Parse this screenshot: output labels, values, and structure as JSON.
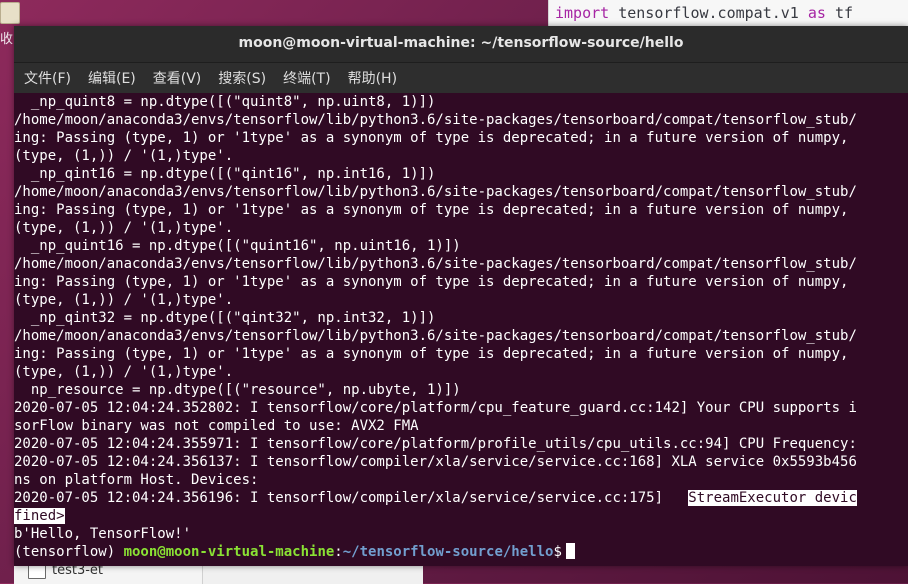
{
  "desktop": {
    "left_fragment": "收",
    "editor_line": {
      "keyword1": "import",
      "module": " tensorflow.compat.v1 ",
      "keyword2": "as",
      "alias": " tf"
    },
    "file_item": "test3-et"
  },
  "terminal": {
    "title": "moon@moon-virtual-machine: ~/tensorflow-source/hello",
    "menu": [
      "文件(F)",
      "编辑(E)",
      "查看(V)",
      "搜索(S)",
      "终端(T)",
      "帮助(H)"
    ],
    "lines": [
      "  _np_quint8 = np.dtype([(\"quint8\", np.uint8, 1)])",
      "/home/moon/anaconda3/envs/tensorflow/lib/python3.6/site-packages/tensorboard/compat/tensorflow_stub/",
      "ing: Passing (type, 1) or '1type' as a synonym of type is deprecated; in a future version of numpy, ",
      "(type, (1,)) / '(1,)type'.",
      "  _np_qint16 = np.dtype([(\"qint16\", np.int16, 1)])",
      "/home/moon/anaconda3/envs/tensorflow/lib/python3.6/site-packages/tensorboard/compat/tensorflow_stub/",
      "ing: Passing (type, 1) or '1type' as a synonym of type is deprecated; in a future version of numpy, ",
      "(type, (1,)) / '(1,)type'.",
      "  _np_quint16 = np.dtype([(\"quint16\", np.uint16, 1)])",
      "/home/moon/anaconda3/envs/tensorflow/lib/python3.6/site-packages/tensorboard/compat/tensorflow_stub/",
      "ing: Passing (type, 1) or '1type' as a synonym of type is deprecated; in a future version of numpy, ",
      "(type, (1,)) / '(1,)type'.",
      "  _np_qint32 = np.dtype([(\"qint32\", np.int32, 1)])",
      "/home/moon/anaconda3/envs/tensorflow/lib/python3.6/site-packages/tensorboard/compat/tensorflow_stub/",
      "ing: Passing (type, 1) or '1type' as a synonym of type is deprecated; in a future version of numpy, ",
      "(type, (1,)) / '(1,)type'.",
      "  np_resource = np.dtype([(\"resource\", np.ubyte, 1)])",
      "2020-07-05 12:04:24.352802: I tensorflow/core/platform/cpu_feature_guard.cc:142] Your CPU supports i",
      "sorFlow binary was not compiled to use: AVX2 FMA",
      "2020-07-05 12:04:24.355971: I tensorflow/core/platform/profile_utils/cpu_utils.cc:94] CPU Frequency:",
      "2020-07-05 12:04:24.356137: I tensorflow/compiler/xla/service/service.cc:168] XLA service 0x5593b456",
      "ns on platform Host. Devices:"
    ],
    "line_se_prefix": "2020-07-05 12:04:24.356196: I tensorflow/compiler/xla/service/service.cc:175]   ",
    "line_se_highlight": "StreamExecutor devic",
    "line_fined": "fined>",
    "line_hello": "b'Hello, TensorFlow!'",
    "prompt": {
      "env": "(tensorflow) ",
      "user_host": "moon@moon-virtual-machine",
      "colon": ":",
      "path": "~/tensorflow-source/hello",
      "dollar": "$"
    }
  }
}
